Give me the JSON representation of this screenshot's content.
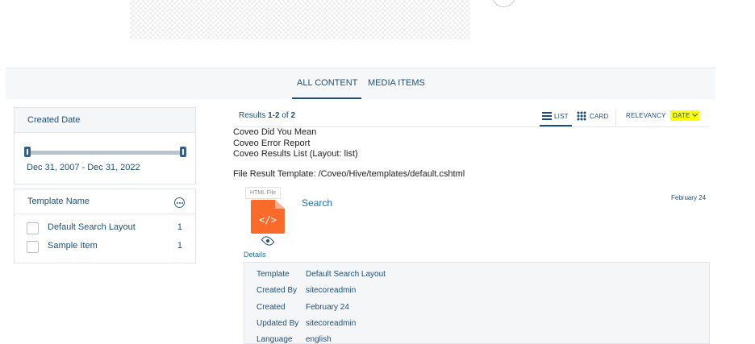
{
  "tabs": [
    {
      "label": "ALL CONTENT",
      "active": true
    },
    {
      "label": "MEDIA ITEMS",
      "active": false
    }
  ],
  "facets": {
    "created_date": {
      "title": "Created Date",
      "range_label": "Dec 31, 2007 - Dec 31, 2022"
    },
    "template_name": {
      "title": "Template Name",
      "values": [
        {
          "label": "Default Search Layout",
          "count": "1"
        },
        {
          "label": "Sample Item",
          "count": "1"
        }
      ]
    }
  },
  "results": {
    "summary_prefix": "Results ",
    "summary_range": "1-2",
    "summary_of": " of ",
    "summary_total": "2",
    "layouts": {
      "list": "LIST",
      "card": "CARD"
    },
    "sort": {
      "relevancy": "RELEVANCY",
      "date": "DATE"
    },
    "debug_lines": [
      "Coveo Did You Mean",
      "Coveo Error Report",
      "Coveo Results List (Layout: list)"
    ],
    "file_template": "File Result Template: /Coveo/Hive/templates/default.cshtml",
    "items": [
      {
        "file_label": "HTML File",
        "icon_glyph": "</>",
        "title": "Search",
        "date": "February 24",
        "details_link": "Details",
        "details": [
          {
            "key": "Template",
            "value": "Default Search Layout"
          },
          {
            "key": "Created By",
            "value": "sitecoreadmin"
          },
          {
            "key": "Created",
            "value": "February 24"
          },
          {
            "key": "Updated By",
            "value": "sitecoreadmin"
          },
          {
            "key": "Language",
            "value": "english"
          }
        ]
      }
    ]
  },
  "colors": {
    "primary": "#1d4f76",
    "link": "#1d6fa5",
    "highlight": "#ffff00",
    "file_icon": "#fa6b2b"
  }
}
